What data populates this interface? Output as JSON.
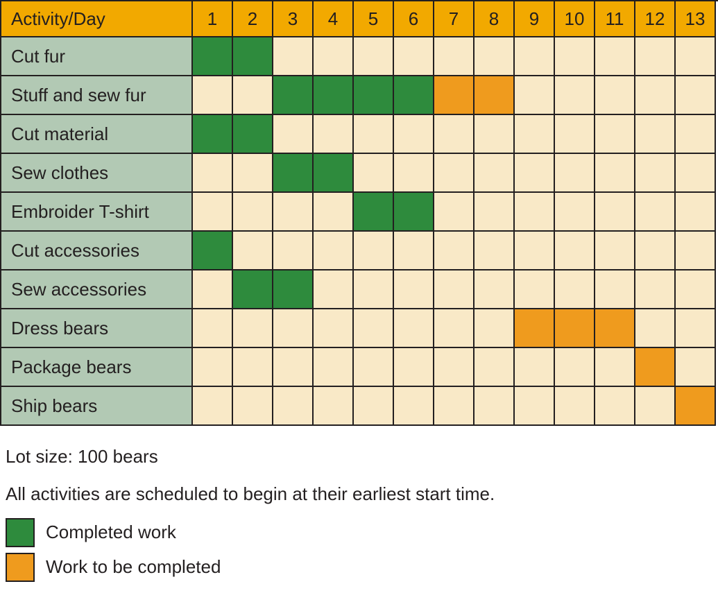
{
  "chart_data": {
    "type": "table",
    "header_label": "Activity/Day",
    "days": [
      1,
      2,
      3,
      4,
      5,
      6,
      7,
      8,
      9,
      10,
      11,
      12,
      13
    ],
    "activities": [
      {
        "name": "Cut fur",
        "cells": [
          "completed",
          "completed",
          "",
          "",
          "",
          "",
          "",
          "",
          "",
          "",
          "",
          "",
          ""
        ]
      },
      {
        "name": "Stuff and sew fur",
        "cells": [
          "",
          "",
          "completed",
          "completed",
          "completed",
          "completed",
          "pending",
          "pending",
          "",
          "",
          "",
          "",
          ""
        ]
      },
      {
        "name": "Cut material",
        "cells": [
          "completed",
          "completed",
          "",
          "",
          "",
          "",
          "",
          "",
          "",
          "",
          "",
          "",
          ""
        ]
      },
      {
        "name": "Sew clothes",
        "cells": [
          "",
          "",
          "completed",
          "completed",
          "",
          "",
          "",
          "",
          "",
          "",
          "",
          "",
          ""
        ]
      },
      {
        "name": "Embroider T-shirt",
        "cells": [
          "",
          "",
          "",
          "",
          "completed",
          "completed",
          "",
          "",
          "",
          "",
          "",
          "",
          ""
        ]
      },
      {
        "name": "Cut accessories",
        "cells": [
          "completed",
          "",
          "",
          "",
          "",
          "",
          "",
          "",
          "",
          "",
          "",
          "",
          ""
        ]
      },
      {
        "name": "Sew accessories",
        "cells": [
          "",
          "completed",
          "completed",
          "",
          "",
          "",
          "",
          "",
          "",
          "",
          "",
          "",
          ""
        ]
      },
      {
        "name": "Dress bears",
        "cells": [
          "",
          "",
          "",
          "",
          "",
          "",
          "",
          "",
          "pending",
          "pending",
          "pending",
          "",
          ""
        ]
      },
      {
        "name": "Package bears",
        "cells": [
          "",
          "",
          "",
          "",
          "",
          "",
          "",
          "",
          "",
          "",
          "",
          "pending",
          ""
        ]
      },
      {
        "name": "Ship bears",
        "cells": [
          "",
          "",
          "",
          "",
          "",
          "",
          "",
          "",
          "",
          "",
          "",
          "",
          "pending"
        ]
      }
    ],
    "colors": {
      "completed": "#2e8b3d",
      "pending": "#ef9b1e",
      "header_bg": "#f2a900",
      "activity_bg": "#b2c9b4",
      "empty_bg": "#f9e9c7"
    }
  },
  "notes": {
    "lot_size": "Lot size: 100 bears",
    "schedule_note": "All activities are scheduled to begin at their earliest start time."
  },
  "legend": {
    "completed": "Completed work",
    "pending": "Work to be completed"
  }
}
